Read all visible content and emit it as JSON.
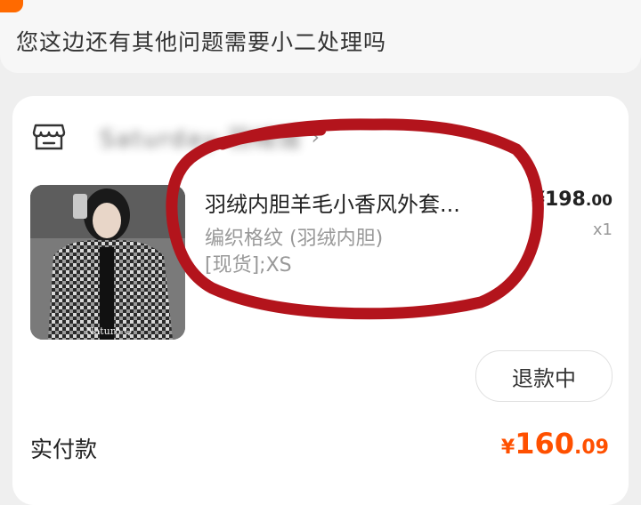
{
  "top": {
    "question": "您这边还有其他问题需要小二处理吗"
  },
  "order": {
    "store_icon": "store-icon",
    "store_name": "Saturday·羽绒馆",
    "product_title": "羽绒内胆羊毛小香风外套...",
    "spec_line1": "编织格纹 (羽绒内胆)",
    "spec_line2": "[现货];XS",
    "price_currency": "¥",
    "price_int": "198",
    "price_dec": ".00",
    "quantity": "x1",
    "refund_status": "退款中",
    "paid_label": "实付款",
    "paid_currency": "¥",
    "paid_int": "160",
    "paid_dec": ".09",
    "thumb_caption": "Naturo Q"
  },
  "colors": {
    "accent": "#ff5000",
    "annotation": "#b3141c"
  }
}
